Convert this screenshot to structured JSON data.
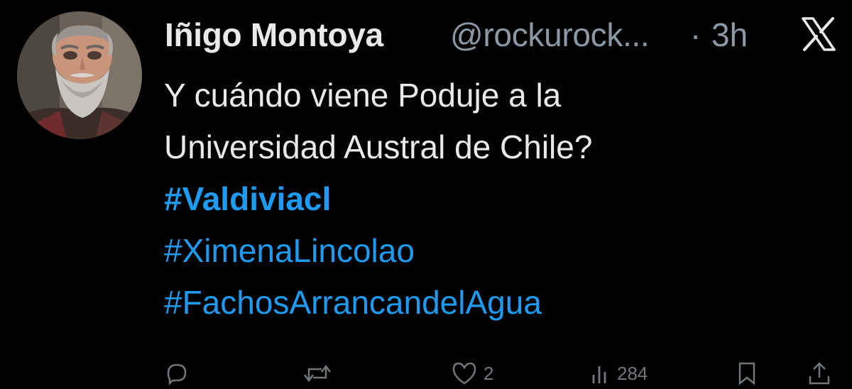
{
  "tweet": {
    "author": {
      "display_name": "Iñigo Montoya",
      "handle": "@rockurock...",
      "avatar": "bearded-man-avatar"
    },
    "separator": "·",
    "time": "3h",
    "platform_icon": "x-logo-icon",
    "body_lines": [
      "Y cuándo viene Poduje a la",
      "Universidad Austral de Chile?"
    ],
    "hashtags": [
      "#Valdiviacl",
      "#XimenaLincolao",
      "#FachosArrancandelAgua"
    ],
    "actions": {
      "reply": {
        "icon": "reply-icon",
        "count": ""
      },
      "retweet": {
        "icon": "retweet-icon",
        "count": ""
      },
      "like": {
        "icon": "heart-icon",
        "count": "2"
      },
      "views": {
        "icon": "views-icon",
        "count": "284"
      },
      "bookmark": {
        "icon": "bookmark-icon",
        "count": ""
      },
      "share": {
        "icon": "share-icon",
        "count": ""
      }
    }
  },
  "colors": {
    "background": "#000000",
    "text_primary": "#e7e9ea",
    "text_secondary": "#8b98a5",
    "hashtag": "#1d9bf0",
    "action_icon": "#71767b"
  }
}
